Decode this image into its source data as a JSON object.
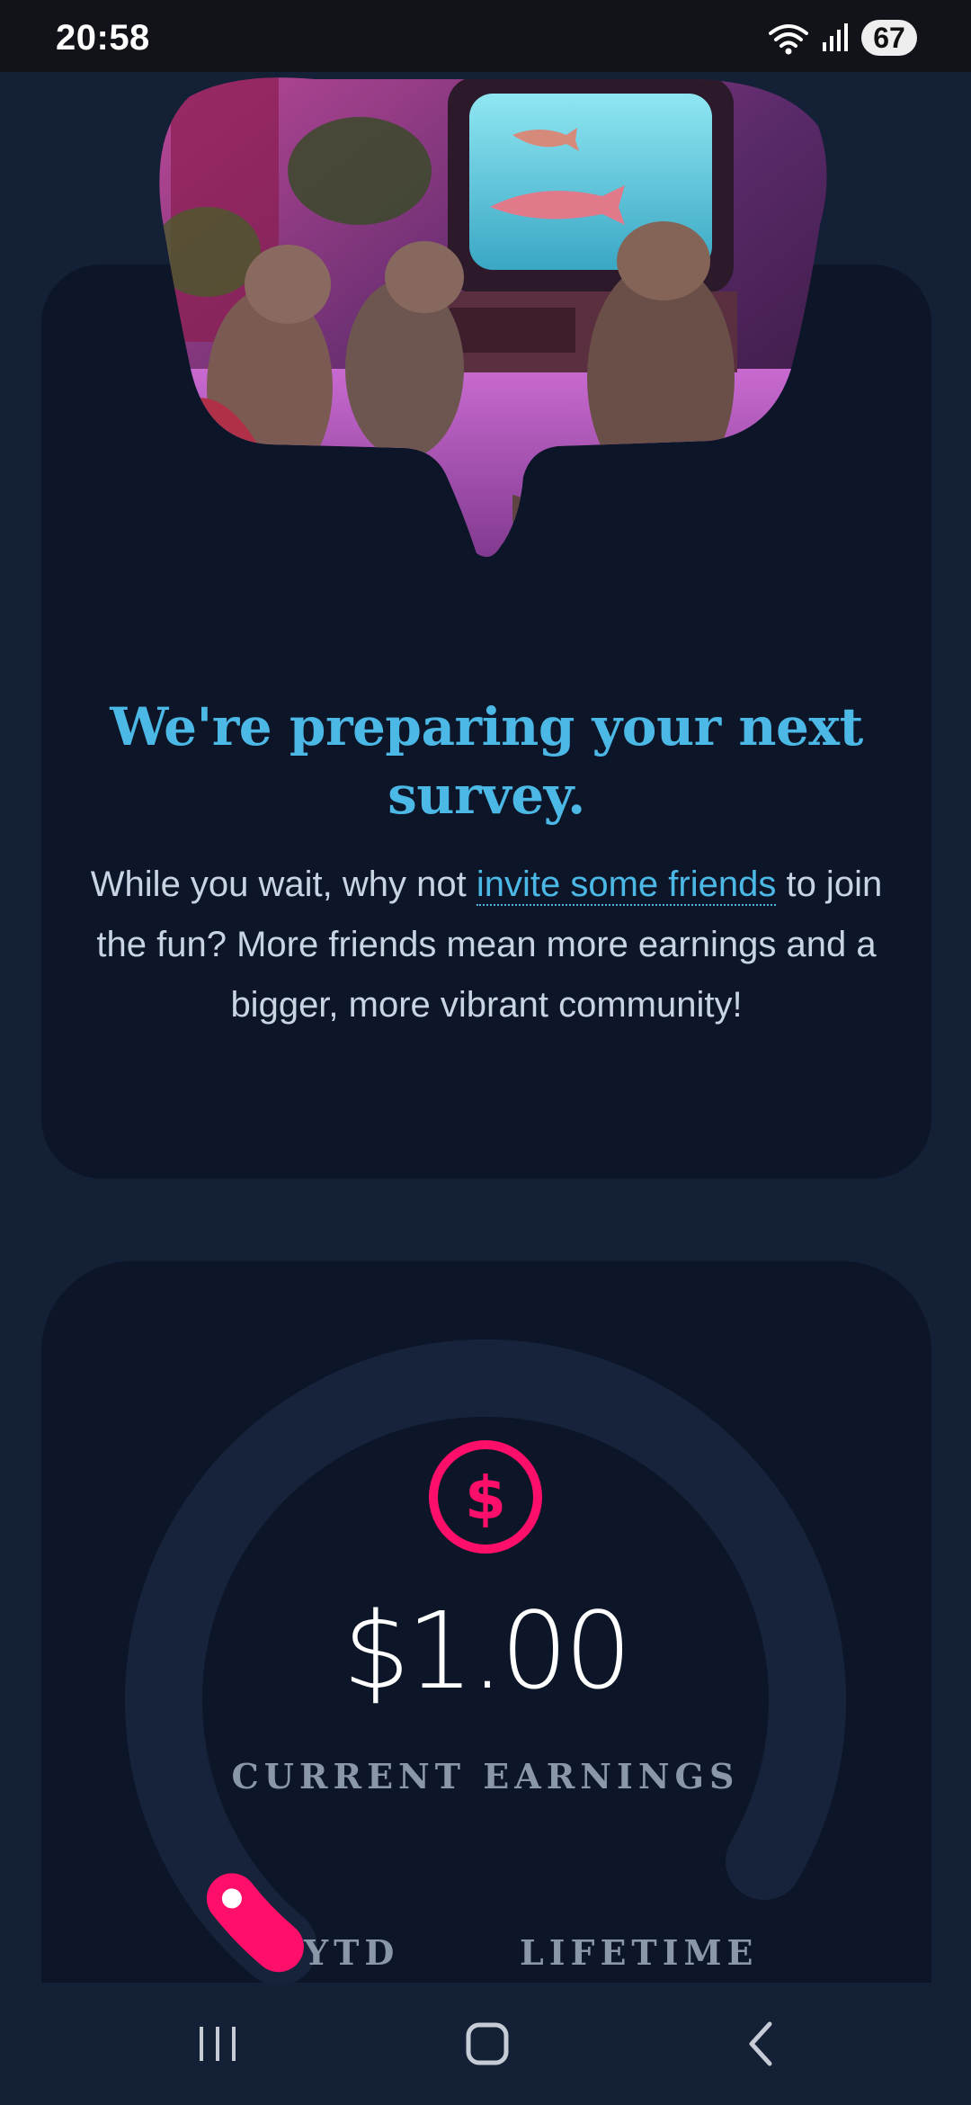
{
  "status_bar": {
    "time": "20:58",
    "battery": "67",
    "icons": [
      "wifi-icon",
      "signal-icon",
      "battery-icon"
    ]
  },
  "survey_card": {
    "title": "We're preparing your next survey.",
    "body_prefix": "While you wait, why not ",
    "link_text": "invite some friends",
    "body_suffix": " to join the fun? More friends mean more earnings and a bigger, more vibrant community!"
  },
  "earnings_card": {
    "icon": "dollar-circle-icon",
    "amount": "$1.00",
    "label": "CURRENT EARNINGS",
    "ytd_label": "YTD",
    "lifetime_label": "LIFETIME",
    "progress_fraction": 0.02
  },
  "nav": {
    "buttons": [
      "recent-apps-icon",
      "home-icon",
      "back-icon"
    ]
  },
  "colors": {
    "background": "#142036",
    "card": "#0d1628",
    "accent_blue": "#4bb8e6",
    "accent_pink": "#ff0f6a",
    "muted_text": "#8a97a9"
  }
}
